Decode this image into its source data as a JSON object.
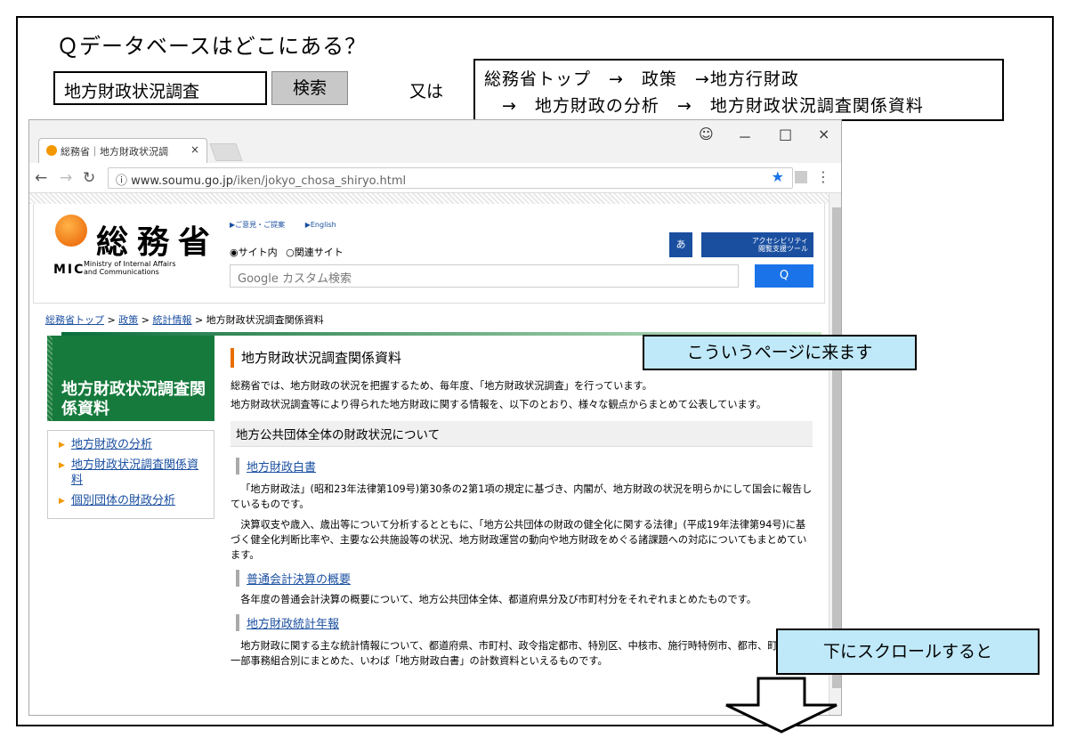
{
  "question": "Ｑデータベースはどこにある？",
  "search": {
    "query": "地方財政状況調査",
    "button": "検索"
  },
  "or_label": "又は",
  "nav_path": {
    "line1": "総務省トップ　→　政策　→地方行財政",
    "line2": "→　地方財政の分析　→　地方財政状況調査関係資料"
  },
  "browser": {
    "tab_title": "総務省｜地方財政状況調",
    "tab_close": "×",
    "win_min": "－",
    "win_max": "□",
    "win_close": "×",
    "url_host": "www.soumu.go.jp",
    "url_path": "/iken/jokyo_chosa_shiryo.html"
  },
  "site": {
    "logo_kanji": "総務省",
    "logo_abbr": "MIC",
    "logo_en1": "Ministry of Internal Affairs",
    "logo_en2": "and Communications",
    "link_opinion": "ご意見・ご提案",
    "link_english": "English",
    "radio_site": "サイト内",
    "radio_related": "関連サイト",
    "search_placeholder": "Google カスタム検索",
    "search_btn": "Q",
    "kana_btn": "あ",
    "acc_label1": "アクセシビリティ",
    "acc_label2": "閲覧支援ツール"
  },
  "breadcrumb": {
    "top": "総務省トップ",
    "policy": "政策",
    "stats": "統計情報",
    "current": "地方財政状況調査関係資料",
    "sep": ">"
  },
  "sidebar": {
    "banner": "地方財政状況調査関係資料",
    "items": [
      {
        "label": "地方財政の分析"
      },
      {
        "label": "地方財政状況調査関係資料"
      },
      {
        "label": "個別団体の財政分析"
      }
    ]
  },
  "main": {
    "title": "地方財政状況調査関係資料",
    "intro1": "総務省では、地方財政の状況を把握するため、毎年度、「地方財政状況調査」を行っています。",
    "intro2": "地方財政状況調査等により得られた地方財政に関する情報を、以下のとおり、様々な観点からまとめて公表しています。",
    "section": "地方公共団体全体の財政状況について",
    "h_white": "地方財政白書",
    "p_white1": "「地方財政法」(昭和23年法律第109号)第30条の2第1項の規定に基づき、内閣が、地方財政の状況を明らかにして国会に報告しているものです。",
    "p_white2": "決算収支や歳入、歳出等について分析するとともに、「地方公共団体の財政の健全化に関する法律」(平成19年法律第94号)に基づく健全化判断比率や、主要な公共施設等の状況、地方財政運営の動向や地方財政をめぐる諸課題への対応についてもまとめています。",
    "h_summary": "普通会計決算の概要",
    "p_summary": "各年度の普通会計決算の概要について、地方公共団体全体、都道府県分及び市町村分をそれぞれまとめたものです。",
    "h_yearbook": "地方財政統計年報",
    "p_yearbook": "地方財政に関する主な統計情報について、都道府県、市町村、政令指定都市、特別区、中核市、施行時特例市、都市、町村及び一部事務組合別にまとめた、いわば「地方財政白書」の計数資料といえるものです。"
  },
  "callouts": {
    "page_arrival": "こういうページに来ます",
    "scroll_down": "下にスクロールすると"
  }
}
